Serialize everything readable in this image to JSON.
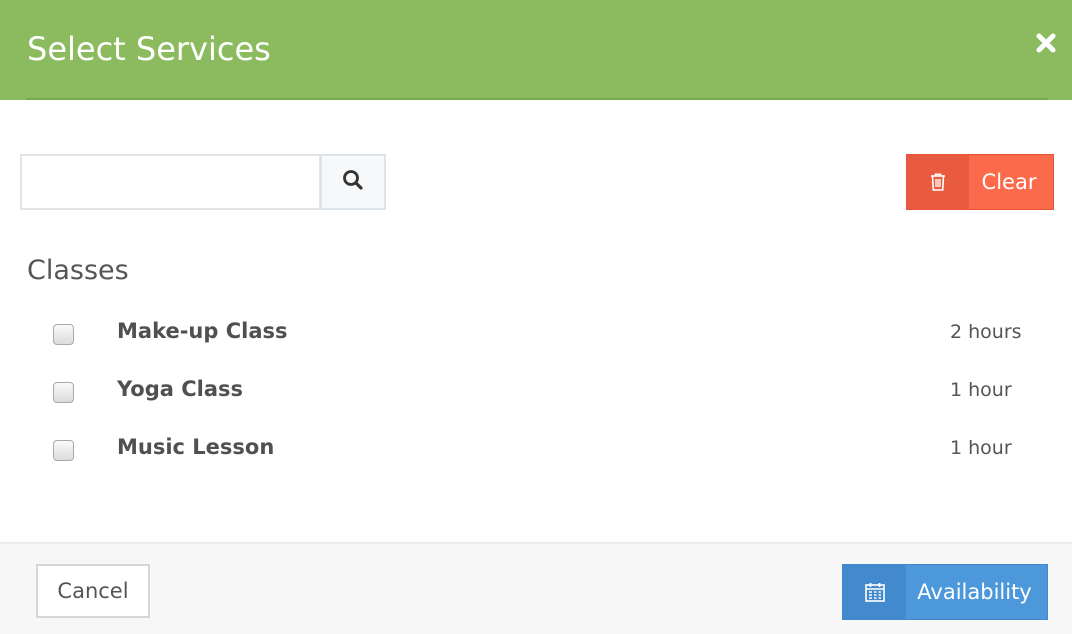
{
  "header": {
    "title": "Select Services",
    "close_icon": "close-icon",
    "background": "#8cbb5f"
  },
  "search": {
    "value": "",
    "placeholder": "",
    "button_icon": "search-icon"
  },
  "clear_button": {
    "label": "Clear",
    "icon": "trash-icon",
    "color": "#fb6a4b"
  },
  "section": {
    "title": "Classes",
    "services": [
      {
        "name": "Make-up Class",
        "duration": "2 hours",
        "checked": false
      },
      {
        "name": "Yoga Class",
        "duration": "1 hour",
        "checked": false
      },
      {
        "name": "Music Lesson",
        "duration": "1 hour",
        "checked": false
      }
    ]
  },
  "footer": {
    "cancel_label": "Cancel",
    "availability_label": "Availability",
    "availability_icon": "calendar-icon",
    "availability_color": "#4d98da"
  }
}
